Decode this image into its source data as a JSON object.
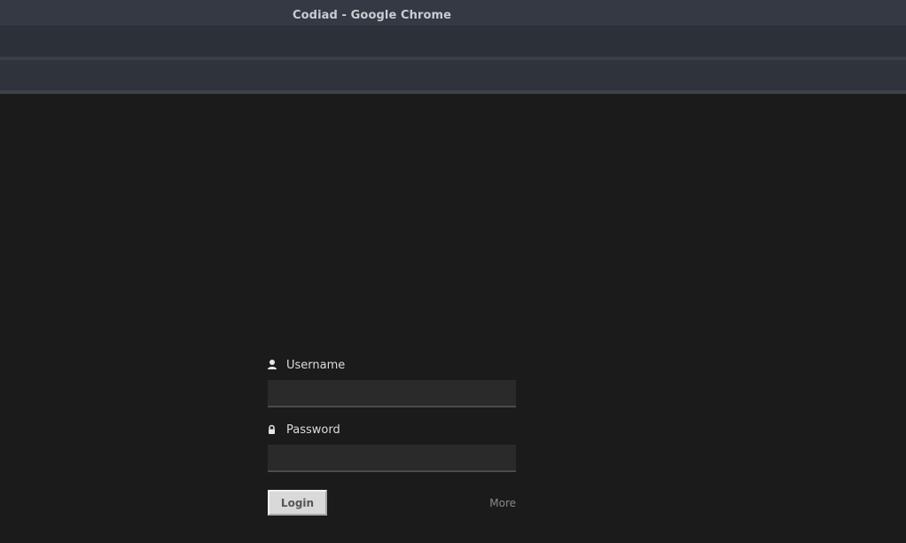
{
  "window": {
    "title": "Codiad - Google Chrome"
  },
  "login": {
    "username_label": "Username",
    "username_value": "",
    "password_label": "Password",
    "password_value": "",
    "login_button": "Login",
    "more_link": "More"
  },
  "icons": {
    "username": "user-icon",
    "password": "lock-icon"
  },
  "colors": {
    "background": "#1b1b1b",
    "titlebar": "#343943",
    "input_background": "#2a2a2a",
    "button_background": "#d9d9d9"
  }
}
